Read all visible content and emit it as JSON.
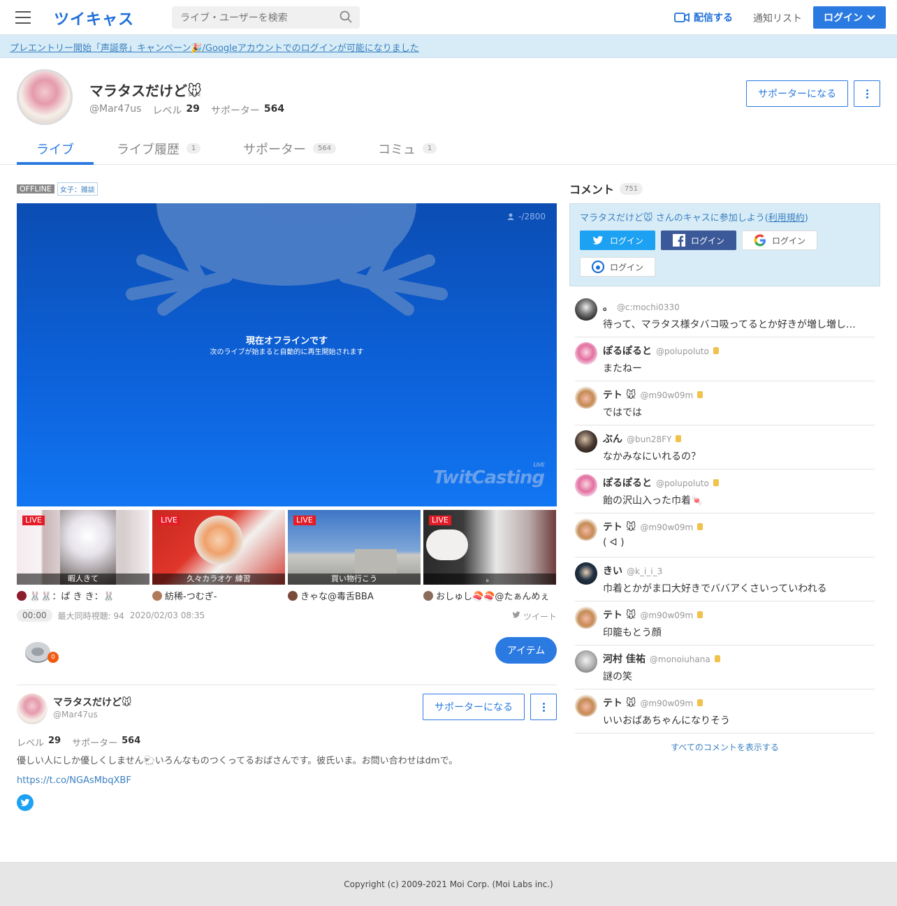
{
  "header": {
    "logo": "ツイキャス",
    "search_placeholder": "ライブ・ユーザーを検索",
    "broadcast_label": "配信する",
    "notify_label": "通知リスト",
    "login_label": "ログイン"
  },
  "banner": {
    "text": "プレエントリー開始「声誕祭」キャンペーン🎉/Googleアカウントでのログインが可能になりました"
  },
  "profile": {
    "name": "マラタスだけど🐭",
    "id": "@Mar47us",
    "level_label": "レベル",
    "level": "29",
    "supporter_label": "サポーター",
    "supporters": "564",
    "support_button": "サポーターになる"
  },
  "tabs": [
    {
      "label": "ライブ",
      "count": ""
    },
    {
      "label": "ライブ履歴",
      "count": "1"
    },
    {
      "label": "サポーター",
      "count": "564"
    },
    {
      "label": "コミュ",
      "count": "1"
    }
  ],
  "live": {
    "status": "OFFLINE",
    "category": "女子：雑談",
    "viewers": "-/2800",
    "offline_title": "現在オフラインです",
    "offline_sub": "次のライブが始まると自動的に再生開始されます",
    "watermark": "TwitCasting",
    "watermark_sub": "LIVE",
    "time": "00:00",
    "max_viewers": "最大同時視聴: 94",
    "date": "2020/02/03 08:35",
    "tweet_label": "ツイート",
    "coin_count": "0",
    "items_button": "アイテム"
  },
  "thumbs": [
    {
      "badge": "LIVE",
      "title": "暇人きて",
      "user": "🐰🐰：ぱ き き：🐰"
    },
    {
      "badge": "LIVE",
      "title": "久々カラオケ 練習",
      "user": "紡稀-つむぎ-"
    },
    {
      "badge": "LIVE",
      "title": "買い物行こう",
      "user": "きゃな@毒舌BBA"
    },
    {
      "badge": "LIVE",
      "title": "。",
      "user": "おしゅし🍣🍣@たぁんめぇ"
    }
  ],
  "about": {
    "name": "マラタスだけど🐭",
    "id": "@Mar47us",
    "level_label": "レベル",
    "level": "29",
    "supporter_label": "サポーター",
    "supporters": "564",
    "bio": "優しい人にしか優しくしません🐑いろんなものつくってるおばさんです。彼氏いま。お問い合わせはdmで。",
    "link": "https://t.co/NGAsMbqXBF",
    "support_button": "サポーターになる"
  },
  "comments_panel": {
    "title": "コメント",
    "count": "751",
    "join_text_pre": "マラタスだけど🐭 さんのキャスに参加しよう(",
    "join_terms": "利用規約",
    "join_text_post": ")",
    "login_twitter": "ログイン",
    "login_facebook": "ログイン",
    "login_google": "ログイン",
    "login_twitcasting": "ログイン",
    "show_all": "すべてのコメントを表示する"
  },
  "comments": [
    {
      "name": "。",
      "id": "@c:mochi0330",
      "text": "待って、マラタス様タバコ吸ってるとか好きが増し増し…",
      "medal": false
    },
    {
      "name": "ぽるぽると",
      "id": "@polupoluto",
      "text": "またねー",
      "medal": true
    },
    {
      "name": "テト 🐭",
      "id": "@m90w09m",
      "text": "ではでは",
      "medal": true
    },
    {
      "name": "ぶん",
      "id": "@bun28FY",
      "text": "なかみなにいれるの？",
      "medal": true
    },
    {
      "name": "ぽるぽると",
      "id": "@polupoluto",
      "text": "飴の沢山入った巾着🍬",
      "medal": true
    },
    {
      "name": "テト 🐭",
      "id": "@m90w09m",
      "text": "( ᐊ )",
      "medal": true
    },
    {
      "name": "きい",
      "id": "@k_i_i_3",
      "text": "巾着とかがま口大好きでババアくさいっていわれる",
      "medal": false
    },
    {
      "name": "テト 🐭",
      "id": "@m90w09m",
      "text": "印籠もとう顔",
      "medal": true
    },
    {
      "name": "河村 佳祐",
      "id": "@monoiuhana",
      "text": "謎の笑",
      "medal": true
    },
    {
      "name": "テト 🐭",
      "id": "@m90w09m",
      "text": "いいおばあちゃんになりそう",
      "medal": true
    }
  ],
  "footer": {
    "copyright": "Copyright (c) 2009-2021 Moi Corp. (Moi Labs inc.)"
  },
  "colors": {
    "accent": "#2a7ae2",
    "live_badge": "#e41c28",
    "banner_bg": "#d7ecf6"
  }
}
